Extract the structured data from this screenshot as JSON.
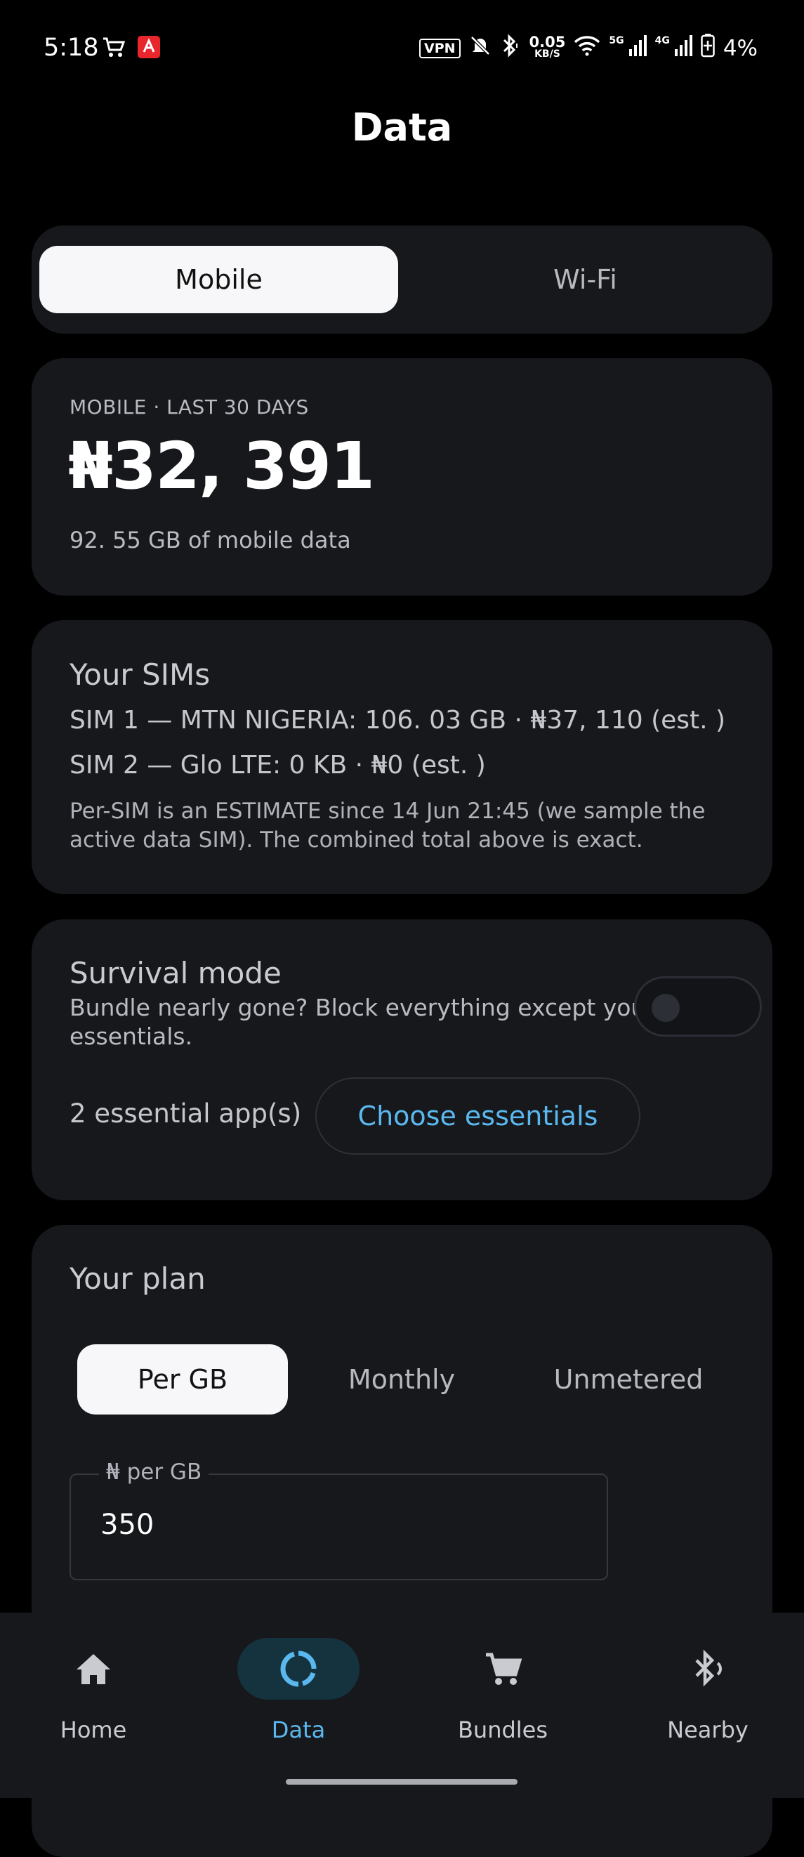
{
  "status_bar": {
    "time": "5:18",
    "vpn": "VPN",
    "speed_value": "0.05",
    "speed_unit": "KB/S",
    "net1": "5G",
    "net2": "4G",
    "battery": "4%",
    "icons": [
      "shopping-cart-icon",
      "app-notification-icon",
      "mute-icon",
      "bluetooth-icon",
      "wifi-icon",
      "signal-icon",
      "battery-icon"
    ]
  },
  "header": {
    "title": "Data"
  },
  "segment": {
    "mobile": "Mobile",
    "wifi": "Wi-Fi",
    "selected": "Mobile"
  },
  "summary": {
    "overline": "MOBILE · LAST 30 DAYS",
    "amount": "₦32, 391",
    "sub": "92. 55 GB of mobile data"
  },
  "sims": {
    "title": "Your SIMs",
    "sim1": "SIM 1 — MTN NIGERIA: 106. 03 GB · ₦37, 110 (est. )",
    "sim2": "SIM 2 — Glo LTE: 0 KB · ₦0 (est. )",
    "note": "Per-SIM is an ESTIMATE since 14 Jun 21:45 (we sample the active data SIM).  The combined total above is exact."
  },
  "survival": {
    "title": "Survival mode",
    "description": "Bundle nearly gone?  Block everything except your essentials.",
    "enabled": false,
    "essentials_count": "2 essential app(s)",
    "choose_button": "Choose essentials"
  },
  "plan": {
    "title": "Your plan",
    "options": [
      "Per GB",
      "Monthly",
      "Unmetered"
    ],
    "selected": "Per GB",
    "field_label": "₦ per GB",
    "field_value": "350"
  },
  "bottom_nav": {
    "items": [
      {
        "label": "Home",
        "icon": "home-icon"
      },
      {
        "label": "Data",
        "icon": "data-ring-icon"
      },
      {
        "label": "Bundles",
        "icon": "cart-icon"
      },
      {
        "label": "Nearby",
        "icon": "bluetooth-nearby-icon"
      }
    ],
    "active": "Data"
  },
  "colors": {
    "background": "#000000",
    "card": "#16181c",
    "accent": "#5bb8ef",
    "active_pill": "#15323f",
    "segment_active": "#f7f7f9"
  }
}
